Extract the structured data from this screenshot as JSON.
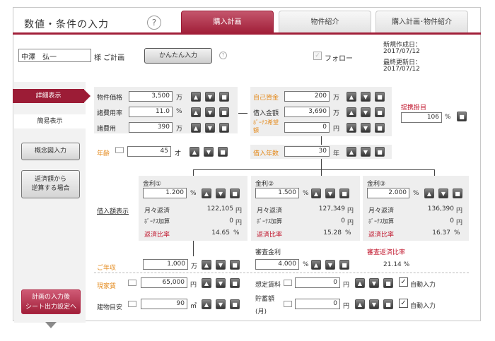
{
  "header": {
    "title": "数値・条件の入力",
    "help": "?",
    "tabs": [
      "購入計画",
      "物件紹介",
      "購入計画･物件紹介"
    ]
  },
  "customer": {
    "name": "中澤　弘一",
    "suffix": "様 ご計画",
    "easy_button": "かんたん入力",
    "help": "?",
    "follow": "フォロー",
    "created_label": "新規作成日：",
    "created": "2017/07/12",
    "updated_label": "最終更新日：",
    "updated": "2017/07/12"
  },
  "sidebar": {
    "detail": "詳細表示",
    "simple": "簡易表示",
    "overview": "概念図入力",
    "reverse": "返済額から\n逆算する場合",
    "output": "計画の入力後\nシート出力設定へ"
  },
  "icons": {
    "up": "up-arrow-icon",
    "down": "down-arrow-icon",
    "stop": "square-icon"
  },
  "purchase": {
    "price_label": "物件価格",
    "price": "3,500",
    "price_unit": "万",
    "ratio_label": "諸費用率",
    "ratio": "11.0",
    "ratio_unit": "%",
    "cost_label": "諸費用",
    "cost": "390",
    "cost_unit": "万",
    "own_label": "自己資金",
    "own": "200",
    "own_unit": "万",
    "loan_label": "借入金額",
    "loan": "3,690",
    "loan_unit": "万",
    "bonus_label": "ﾎﾞｰﾅｽ希望額",
    "bonus": "0",
    "bonus_unit": "円",
    "guarantee_label": "提携掛目",
    "guarantee": "106",
    "guarantee_unit": "%",
    "age_label": "年齢",
    "age": "45",
    "age_unit": "才",
    "years_label": "借入年数",
    "years": "30",
    "years_unit": "年"
  },
  "rates_link": "借入額表示",
  "rates": [
    {
      "title": "金利①",
      "rate": "1.200",
      "unit": "%",
      "monthly_label": "月々返済",
      "monthly": "122,105",
      "monthly_unit": "円",
      "bonus_label": "ﾎﾞｰﾅｽ加算",
      "bonus": "0",
      "bonus_unit": "円",
      "ratio_label": "返済比率",
      "ratio": "14.65",
      "ratio_unit": "%"
    },
    {
      "title": "金利②",
      "rate": "1.500",
      "unit": "%",
      "monthly_label": "月々返済",
      "monthly": "127,349",
      "monthly_unit": "円",
      "bonus_label": "ﾎﾞｰﾅｽ加算",
      "bonus": "0",
      "bonus_unit": "円",
      "ratio_label": "返済比率",
      "ratio": "15.28",
      "ratio_unit": "%"
    },
    {
      "title": "金利③",
      "rate": "2.000",
      "unit": "%",
      "monthly_label": "月々返済",
      "monthly": "136,390",
      "monthly_unit": "円",
      "bonus_label": "ﾎﾞｰﾅｽ加算",
      "bonus": "0",
      "bonus_unit": "円",
      "ratio_label": "返済比率",
      "ratio": "16.37",
      "ratio_unit": "%"
    }
  ],
  "income": {
    "label": "ご年収",
    "value": "1,000",
    "unit": "万",
    "review_label": "審査金利",
    "review": "4.000",
    "review_unit": "%",
    "review_ratio_label": "審査返済比率",
    "review_ratio": "21.14 %"
  },
  "rent": {
    "label": "現家賃",
    "value": "65,000",
    "unit": "円",
    "assumed_label": "想定賃料",
    "assumed": "0",
    "assumed_unit": "円",
    "auto": "自動入力"
  },
  "building": {
    "label": "建物目安",
    "value": "90",
    "unit": "㎡",
    "savings_label": "貯蓄額",
    "savings_sub": "(月)",
    "savings": "0",
    "savings_unit": "円",
    "auto": "自動入力"
  }
}
